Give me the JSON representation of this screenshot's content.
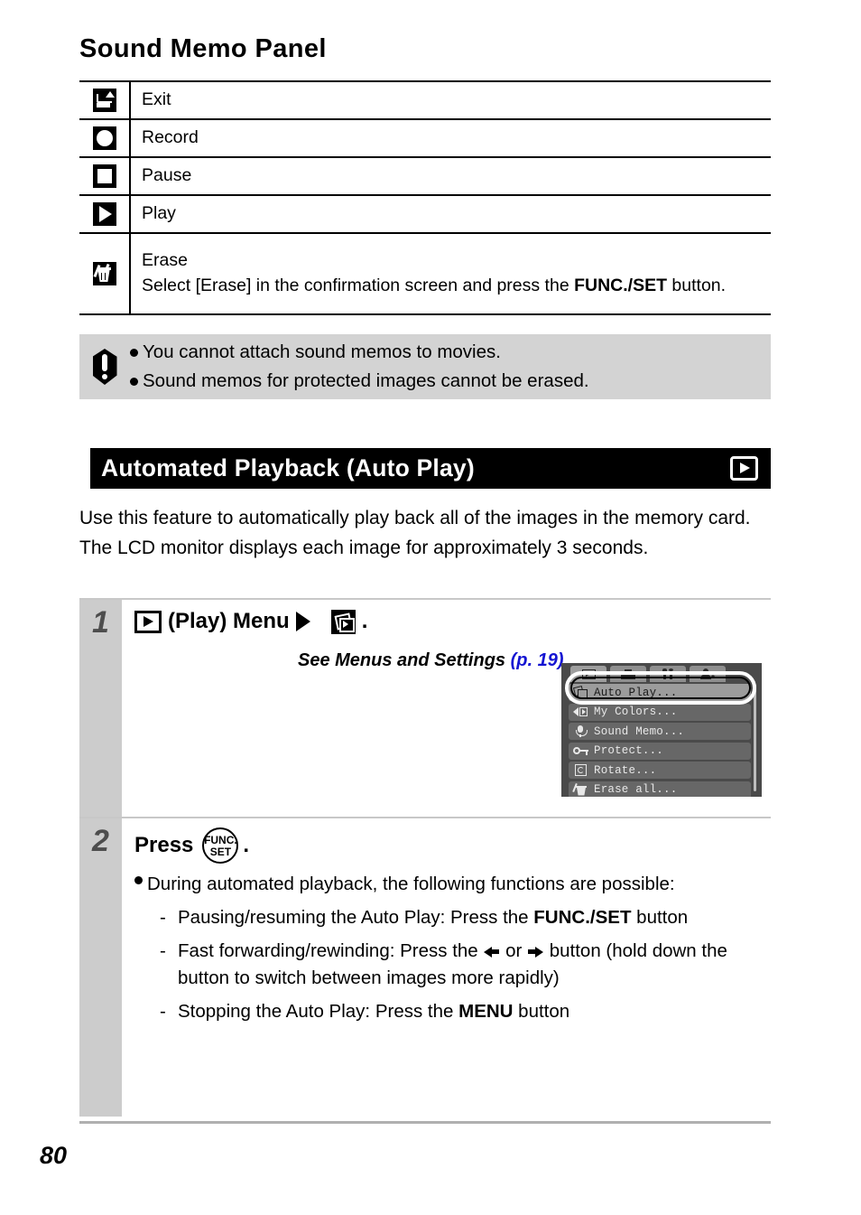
{
  "page": {
    "title": "Sound Memo Panel",
    "number": "80"
  },
  "memo_table": {
    "rows": [
      {
        "icon": "exit-icon",
        "label": "Exit",
        "detail": ""
      },
      {
        "icon": "record-icon",
        "label": "Record",
        "detail": ""
      },
      {
        "icon": "pause-icon",
        "label": "Pause",
        "detail": ""
      },
      {
        "icon": "play-icon",
        "label": "Play",
        "detail": ""
      },
      {
        "icon": "erase-trash-icon",
        "label": "Erase",
        "detail_pre": "Select [Erase] in the confirmation screen and press the ",
        "detail_bold": "FUNC./SET",
        "detail_post": " button."
      }
    ]
  },
  "note": {
    "icon": "exclamation-icon",
    "items": [
      "You cannot attach sound memos to movies.",
      "Sound memos for protected images cannot be erased."
    ]
  },
  "section": {
    "heading": "Automated Playback (Auto Play)",
    "badge_icon": "play-badge-icon",
    "intro": "Use this feature to automatically play back all of the images in the memory card. The LCD monitor displays each image for approximately 3 seconds."
  },
  "steps": [
    {
      "number": "1",
      "heading_parts": {
        "play_icon": "play-menu-icon",
        "text": "(Play) Menu",
        "arrow_icon": "triangle-right-icon",
        "autoplay_icon": "auto-play-icon",
        "period": "."
      },
      "reference": {
        "text": "See Menus and Settings ",
        "pageref": "(p. 19)",
        "period": "."
      }
    },
    {
      "number": "2",
      "heading": "Press",
      "button": {
        "line1": "FUNC.",
        "line2": "SET"
      },
      "period": ".",
      "bullet": "During automated playback, the following functions are possible:",
      "sub_items": [
        {
          "dash": "-",
          "pre": "Pausing/resuming the Auto Play: Press the ",
          "bold": "FUNC./SET",
          "post": " button"
        },
        {
          "dash": "-",
          "pre": "Fast forwarding/rewinding: Press the ",
          "mid": " or ",
          "post": " button (hold down the button to switch between images more rapidly)",
          "left_arrow_icon": "arrow-left-icon",
          "right_arrow_icon": "arrow-right-icon"
        },
        {
          "dash": "-",
          "pre": "Stopping the Auto Play: Press the ",
          "bold": "MENU",
          "post": " button"
        }
      ]
    }
  ],
  "lcd": {
    "tabs": [
      {
        "name": "play-tab",
        "icon": "play-tab-icon",
        "active": true
      },
      {
        "name": "print-tab",
        "icon": "print-tab-icon",
        "active": false
      },
      {
        "name": "setup-tab",
        "icon": "tools-tab-icon",
        "active": false
      },
      {
        "name": "my-camera-tab",
        "icon": "my-camera-tab-icon",
        "active": false
      }
    ],
    "items": [
      {
        "icon": "auto-play-menu-icon",
        "label": "Auto Play...",
        "selected": true
      },
      {
        "icon": "my-colors-menu-icon",
        "label": "My Colors...",
        "selected": false
      },
      {
        "icon": "microphone-menu-icon",
        "label": "Sound Memo...",
        "selected": false
      },
      {
        "icon": "key-menu-icon",
        "label": "Protect...",
        "selected": false
      },
      {
        "icon": "rotate-menu-icon",
        "label": "Rotate...",
        "selected": false
      },
      {
        "icon": "erase-all-menu-icon",
        "label": "Erase all...",
        "selected": false
      }
    ]
  },
  "colors": {
    "note_background": "#d3d3d3",
    "section_bar": "#000000",
    "step_column": "#cccccc",
    "step_number": "#4d4d4d",
    "page_reference_link": "#1414d2",
    "lcd_background": "#4a4a4a",
    "lcd_item": "#676767",
    "lcd_item_selected": "#9c9c9c"
  }
}
